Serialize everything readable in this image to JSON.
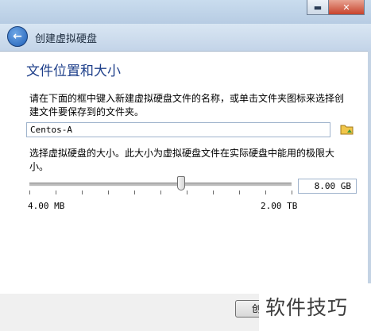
{
  "window": {
    "title": ""
  },
  "header": {
    "title": "创建虚拟硬盘"
  },
  "section": {
    "title": "文件位置和大小"
  },
  "location": {
    "description": "请在下面的框中键入新建虚拟硬盘文件的名称，或单击文件夹图标来选择创建文件要保存到的文件夹。",
    "file_name": "Centos-A"
  },
  "size": {
    "description": "选择虚拟硬盘的大小。此大小为虚拟硬盘文件在实际硬盘中能用的极限大小。",
    "value": "8.00 GB",
    "min_label": "4.00 MB",
    "max_label": "2.00 TB",
    "slider_fraction": 0.58
  },
  "footer": {
    "create_label": "创"
  },
  "watermark": {
    "text": "软件技巧"
  },
  "icons": [
    "minimize-icon",
    "close-icon",
    "back-arrow-icon",
    "folder-icon"
  ]
}
